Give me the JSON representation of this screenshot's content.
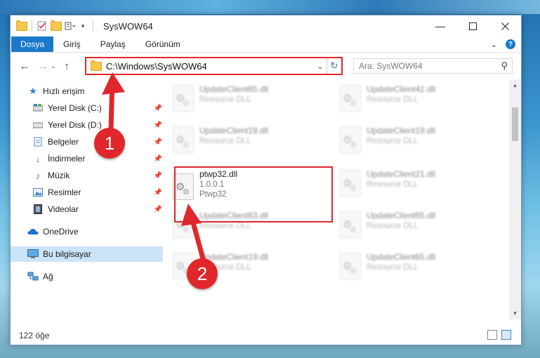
{
  "window": {
    "title": "SysWOW64"
  },
  "ribbon": {
    "tabs": [
      "Dosya",
      "Giriş",
      "Paylaş",
      "Görünüm"
    ]
  },
  "navigation": {
    "address_path": "C:\\Windows\\SysWOW64",
    "search_placeholder": "Ara: SysWOW64"
  },
  "sidebar": {
    "items": [
      {
        "label": "Hızlı erişim",
        "icon": "star-icon",
        "pinned": false
      },
      {
        "label": "Yerel Disk (C:)",
        "icon": "drive-icon",
        "pinned": true
      },
      {
        "label": "Yerel Disk (D:)",
        "icon": "drive-icon",
        "pinned": true
      },
      {
        "label": "Belgeler",
        "icon": "documents-icon",
        "pinned": true
      },
      {
        "label": "İndirmeler",
        "icon": "download-icon",
        "pinned": true
      },
      {
        "label": "Müzik",
        "icon": "music-icon",
        "pinned": true
      },
      {
        "label": "Resimler",
        "icon": "pictures-icon",
        "pinned": true
      },
      {
        "label": "Videolar",
        "icon": "videos-icon",
        "pinned": true
      },
      {
        "label": "OneDrive",
        "icon": "cloud-icon",
        "pinned": false
      },
      {
        "label": "Bu bilgisayar",
        "icon": "computer-icon",
        "pinned": false,
        "selected": true
      },
      {
        "label": "Ağ",
        "icon": "network-icon",
        "pinned": false
      }
    ]
  },
  "files": [
    {
      "name": "UpdateClient65.dll",
      "sub": "Resource DLL",
      "blurred": true
    },
    {
      "name": "UpdateClient42.dll",
      "sub": "Resource DLL",
      "blurred": true
    },
    {
      "name": "UpdateClient19.dll",
      "sub": "Resource DLL",
      "blurred": true
    },
    {
      "name": "UpdateClient19.dll",
      "sub": "Resource DLL",
      "blurred": true
    },
    {
      "name": "ptwp32.dll",
      "version": "1.0.0.1",
      "sub": "Ptwp32",
      "blurred": false
    },
    {
      "name": "UpdateClient21.dll",
      "sub": "Resource DLL",
      "blurred": true
    },
    {
      "name": "UpdateClient63.dll",
      "sub": "Resource DLL",
      "blurred": true
    },
    {
      "name": "UpdateClient65.dll",
      "sub": "Resource DLL",
      "blurred": true
    },
    {
      "name": "UpdateClient19.dll",
      "sub": "Resource DLL",
      "blurred": true
    },
    {
      "name": "UpdateClient65.dll",
      "sub": "Resource DLL",
      "blurred": true
    }
  ],
  "status": {
    "item_count": "122 öğe"
  },
  "annotations": {
    "step1": "1",
    "step2": "2",
    "color": "#e0282c"
  },
  "colors": {
    "accent": "#1979ca",
    "selection": "#cce4f7"
  }
}
